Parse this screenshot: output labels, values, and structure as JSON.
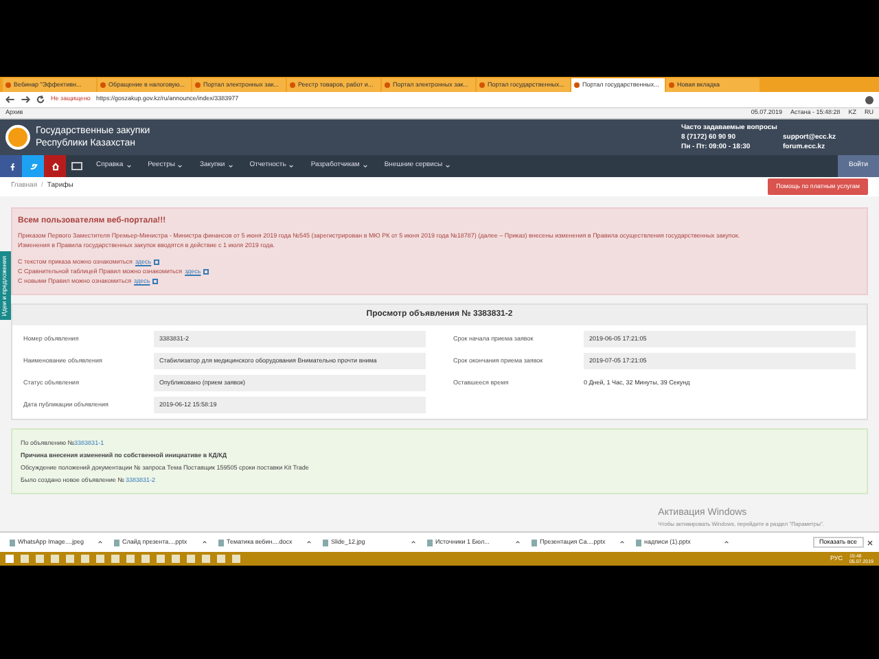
{
  "browser": {
    "tabs": [
      {
        "label": "Вебинар \"Эффективн...",
        "selected": false
      },
      {
        "label": "Обращение в налоговую...",
        "selected": false
      },
      {
        "label": "Портал электронных зак...",
        "selected": false
      },
      {
        "label": "Реестр товаров, работ и...",
        "selected": false
      },
      {
        "label": "Портал электронных зак...",
        "selected": false
      },
      {
        "label": "Портал государственных...",
        "selected": false
      },
      {
        "label": "Портал государственных...",
        "selected": true
      },
      {
        "label": "Новая вкладка",
        "selected": false
      }
    ],
    "security": "Не защищено",
    "url": "https://goszakup.gov.kz/ru/announce/index/3383977",
    "bookmark": "Архив",
    "date": "05.07.2019",
    "clock": "Астана - 15:48:28",
    "langs": [
      "KZ",
      "RU"
    ]
  },
  "site": {
    "title": "Государственные закупки",
    "subtitle": "Республики Казахстан",
    "contacts": [
      "Часто задаваемые вопросы",
      "8 (7172) 60 90 90",
      "support@ecc.kz",
      "Пн - Пт: 09:00 - 18:30",
      "forum.ecc.kz"
    ],
    "nav": [
      "Справка",
      "Реестры",
      "Закупки",
      "Отчетность",
      "Разработчикам",
      "Внешние сервисы"
    ],
    "login": "Войти",
    "breadcrumbs": [
      "Главная",
      "/",
      "Тарифы"
    ],
    "help_button": "Помощь по платным услугам",
    "side_tab": "Идеи и предложения"
  },
  "notice": {
    "title": "Всем пользователям веб-портала!!!",
    "paragraphs": [
      "Приказом Первого Заместителя Премьер-Министра - Министра финансов от 5 июня 2019 года №545 (зарегистрирован в МЮ РК от 5 июня 2019 года №18787) (далее – Приказ) внесены изменения в Правила осуществления государственных закупок.",
      "Изменения в Правила государственных закупок вводятся в действие с 1 июля 2019 года."
    ],
    "links": [
      {
        "text": "С текстом приказа можно ознакомиться",
        "link": "здесь"
      },
      {
        "text": "С Сравнительной таблицей Правил можно ознакомиться",
        "link": "здесь"
      },
      {
        "text": "С новыми Правил можно ознакомиться",
        "link": "здесь"
      }
    ]
  },
  "announcement": {
    "title": "Просмотр объявления № 3383831-2",
    "left": [
      {
        "label": "Номер объявления",
        "value": "3383831-2"
      },
      {
        "label": "Наименование объявления",
        "value": "Стабилизатор для медицинского оборудования Внимательно прочти внима"
      },
      {
        "label": "Статус объявления",
        "value": "Опубликовано (прием заявок)"
      },
      {
        "label": "Дата публикации объявления",
        "value": "2019-06-12 15:58:19"
      }
    ],
    "right": [
      {
        "label": "Срок начала приема заявок",
        "value": "2019-06-05 17:21:05",
        "kind": "field"
      },
      {
        "label": "Срок окончания приема заявок",
        "value": "2019-07-05 17:21:05",
        "kind": "field"
      },
      {
        "label": "Оставшееся время",
        "value": "0 Дней, 1 Час, 32 Минуты, 39 Секунд",
        "kind": "text"
      }
    ]
  },
  "change": {
    "ref_text": "По объявлению №",
    "ref_link": "3383831-1",
    "reason": "Причина внесения изменений по собственной инициативе в КД/КД",
    "details": "Обсуждение положений документации № запроса Тема Поставщик 159505 сроки поставки Kit Trade",
    "new_text": "Было создано новое объявление №",
    "new_link": "3383831-2"
  },
  "activation": [
    "Активация Windows",
    "Чтобы активировать Windows, перейдите в раздел \"Параметры\"."
  ],
  "downloads": {
    "items": [
      "WhatsApp Image....jpeg",
      "Слайд презента....pptx",
      "Тематика вебин....docx",
      "Slide_12.jpg",
      "Источники 1 Бюл...",
      "Презентация Са....pptx",
      "надписи (1).pptx"
    ],
    "show_all": "Показать все"
  },
  "taskbar": {
    "time": "15:48",
    "date": "05.07.2019",
    "lang": "РУС"
  }
}
